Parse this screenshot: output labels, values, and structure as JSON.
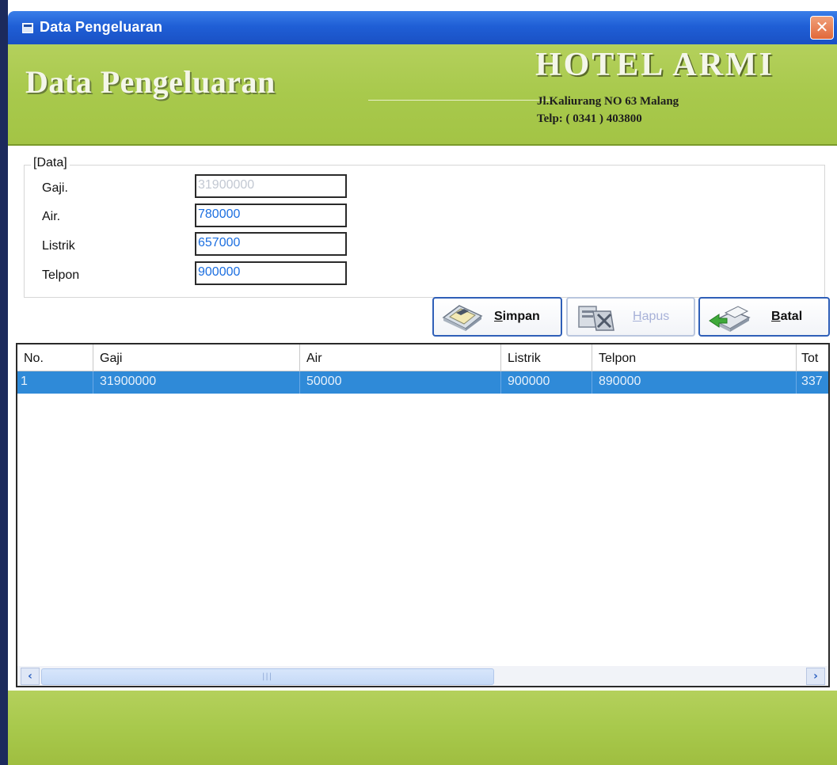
{
  "window": {
    "title": "Data Pengeluaran",
    "close_icon": "close-icon"
  },
  "header": {
    "title": "Data Pengeluaran",
    "hotel_name": "HOTEL ARMI",
    "address": "Jl.Kaliurang NO 63 Malang",
    "phone": "Telp: ( 0341 ) 403800"
  },
  "form": {
    "group_label": "[Data]",
    "fields": [
      {
        "label": "Gaji.",
        "value": "31900000",
        "enabled": false
      },
      {
        "label": "Air.",
        "value": "780000",
        "enabled": true
      },
      {
        "label": "Listrik",
        "value": "657000",
        "enabled": true
      },
      {
        "label": "Telpon",
        "value": "900000",
        "enabled": true
      }
    ]
  },
  "toolbar": {
    "simpan": {
      "accel": "S",
      "rest": "impan",
      "icon": "save-icon",
      "enabled": true
    },
    "hapus": {
      "accel": "H",
      "rest": "apus",
      "icon": "delete-icon",
      "enabled": false
    },
    "batal": {
      "accel": "B",
      "rest": "atal",
      "icon": "cancel-icon",
      "enabled": true
    }
  },
  "grid": {
    "columns": [
      "No.",
      "Gaji",
      "Air",
      "Listrik",
      "Telpon",
      "Tot"
    ],
    "rows": [
      {
        "no": "1",
        "gaji": "31900000",
        "air": "50000",
        "listrik": "900000",
        "telpon": "890000",
        "total": "337"
      }
    ]
  },
  "colors": {
    "title_bar": "#1f5fd6",
    "banner": "#a8c94c",
    "selected_row": "#2f8ad8",
    "input_text": "#1c6fe0"
  }
}
